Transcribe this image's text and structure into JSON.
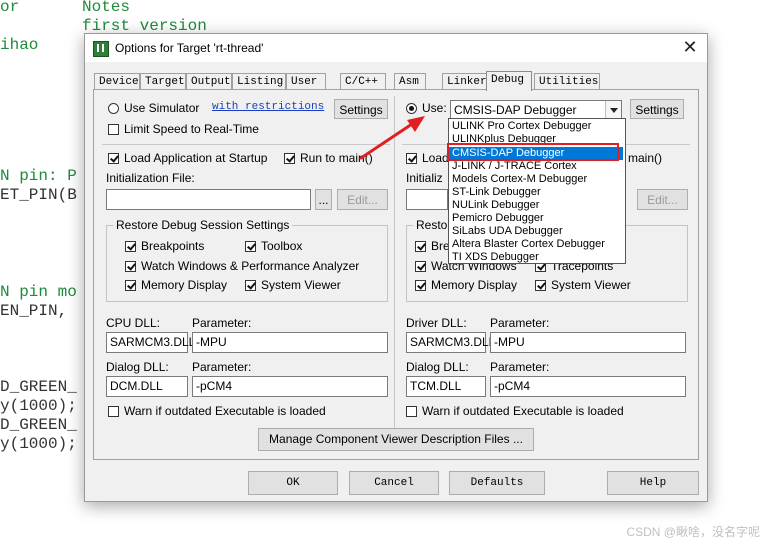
{
  "background_code": [
    {
      "text": "or",
      "color": "green"
    },
    {
      "text": "ihao",
      "color": "green"
    },
    {
      "text": "N pin: P",
      "color": "green"
    },
    {
      "text": "ET_PIN(B",
      "color": "black"
    },
    {
      "text": "N pin mo",
      "color": "green"
    },
    {
      "text": "EN_PIN,",
      "color": "black"
    },
    {
      "text": "D_GREEN_",
      "color": "black"
    },
    {
      "text": "y(1000);",
      "color": "black"
    },
    {
      "text": "D_GREEN_",
      "color": "black"
    },
    {
      "text": "y(1000);",
      "color": "black"
    }
  ],
  "background_notes": [
    "Notes",
    "first version"
  ],
  "dialog": {
    "title": "Options for Target 'rt-thread'",
    "close": "✕"
  },
  "tabs": [
    "Device",
    "Target",
    "Output",
    "Listing",
    "User",
    "C/C++",
    "Asm",
    "Linker",
    "Debug",
    "Utilities"
  ],
  "active_tab": "Debug",
  "left": {
    "use_simulator": "Use Simulator",
    "with_restrictions": "with restrictions",
    "settings": "Settings",
    "limit_speed": "Limit Speed to Real-Time",
    "load_app": "Load Application at Startup",
    "run_to_main": "Run to main()",
    "init_file_label": "Initialization File:",
    "browse": "...",
    "edit": "Edit...",
    "restore_group": "Restore Debug Session Settings",
    "breakpoints": "Breakpoints",
    "toolbox": "Toolbox",
    "watch_windows": "Watch Windows & Performance Analyzer",
    "memory_display": "Memory Display",
    "system_viewer": "System Viewer",
    "cpu_dll_label": "CPU DLL:",
    "param_label": "Parameter:",
    "cpu_dll": "SARMCM3.DLL",
    "cpu_param": "-MPU",
    "dialog_dll_label": "Dialog DLL:",
    "dialog_dll": "DCM.DLL",
    "dialog_param": "-pCM4",
    "warn_outdated": "Warn if outdated Executable is loaded"
  },
  "right": {
    "use": "Use:",
    "debugger_selected": "CMSIS-DAP Debugger",
    "settings": "Settings",
    "load_partial": "Load",
    "run_to_main_partial": "main()",
    "init_partial": "Initializ",
    "edit": "Edit...",
    "restore_partial": "Restore",
    "breakpoints_partial": "Bre",
    "watch_windows": "Watch Windows",
    "tracepoints": "Tracepoints",
    "memory_display": "Memory Display",
    "system_viewer": "System Viewer",
    "driver_dll_label": "Driver DLL:",
    "param_label": "Parameter:",
    "driver_dll": "SARMCM3.DLL",
    "driver_param": "-MPU",
    "dialog_dll_label": "Dialog DLL:",
    "dialog_dll": "TCM.DLL",
    "dialog_param": "-pCM4",
    "warn_outdated": "Warn if outdated Executable is loaded"
  },
  "debugger_options": [
    "ULINK Pro Cortex Debugger",
    "ULINKplus Debugger",
    "CMSIS-DAP Debugger",
    "J-LINK / J-TRACE Cortex",
    "Models Cortex-M Debugger",
    "ST-Link Debugger",
    "NULink Debugger",
    "Pemicro Debugger",
    "SiLabs UDA Debugger",
    "Altera Blaster Cortex Debugger",
    "TI XDS Debugger"
  ],
  "manage_button": "Manage Component Viewer Description Files ...",
  "footer": {
    "ok": "OK",
    "cancel": "Cancel",
    "defaults": "Defaults",
    "help": "Help"
  },
  "watermark": "CSDN @瞅啥，没名字呢",
  "colors": {
    "selection": "#0078d7",
    "highlight_box": "#e02020",
    "annotation_arrow": "#e02020"
  }
}
